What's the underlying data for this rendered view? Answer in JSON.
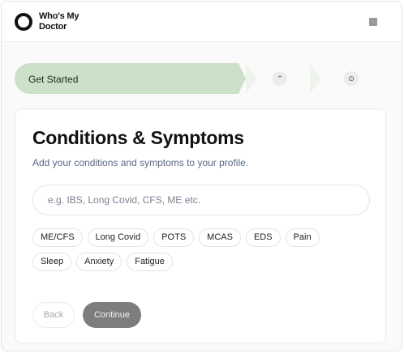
{
  "app": {
    "name_line1": "Who's My",
    "name_line2": "Doctor"
  },
  "stepper": {
    "active_label": "Get Started",
    "step2_icon": "chevrons-up-icon",
    "step2_glyph": "⌃",
    "step3_icon": "circle-dot-icon",
    "step3_glyph": "⊙",
    "active_color": "#cde0c9"
  },
  "form": {
    "title": "Conditions & Symptoms",
    "subtitle": "Add your conditions and symptoms to your profile.",
    "search_placeholder": "e.g. IBS, Long Covid, CFS, ME etc.",
    "chips_row1": [
      "ME/CFS",
      "Long Covid",
      "POTS",
      "MCAS",
      "EDS",
      "Pain"
    ],
    "chips_row2": [
      "Sleep",
      "Anxiety",
      "Fatigue"
    ],
    "back_label": "Back",
    "continue_label": "Continue"
  }
}
